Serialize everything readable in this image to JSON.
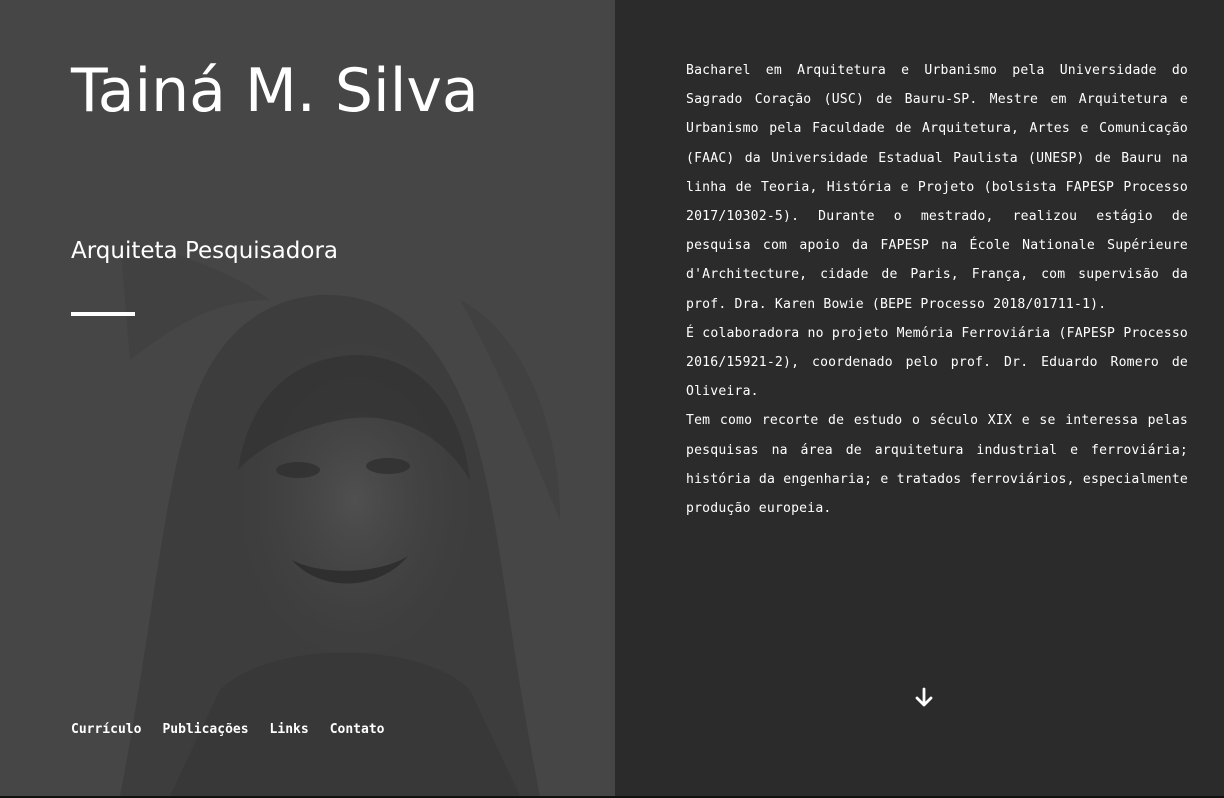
{
  "profile": {
    "name": "Tainá M. Silva",
    "subtitle": "Arquiteta Pesquisadora"
  },
  "nav": {
    "items": [
      "Currículo",
      "Publicações",
      "Links",
      "Contato"
    ]
  },
  "bio": {
    "paragraphs": [
      "Bacharel em Arquitetura e Urbanismo pela Universidade do Sagrado Coração (USC) de Bauru-SP. Mestre em Arquitetura e Urbanismo pela Faculdade de Arquitetura, Artes e Comunicação (FAAC) da Universidade Estadual Paulista (UNESP) de Bauru na linha de Teoria, História e Projeto (bolsista FAPESP Processo 2017/10302-5). Durante o mestrado, realizou estágio de pesquisa com apoio da FAPESP na École Nationale Supérieure d'Architecture, cidade de Paris, França, com supervisão da prof. Dra. Karen Bowie (BEPE Processo 2018/01711-1).",
      "É colaboradora no projeto Memória Ferroviária (FAPESP Processo 2016/15921-2), coordenado pelo prof. Dr. Eduardo Romero de Oliveira.",
      "Tem como recorte de estudo o século XIX e se interessa pelas pesquisas na área de arquitetura industrial e ferroviária; história da engenharia; e tratados ferroviários, especialmente produção europeia."
    ]
  },
  "icons": {
    "scroll": "arrow-down-icon",
    "photo": "portrait-photo"
  },
  "colors": {
    "left_panel": "#464646",
    "right_panel": "#2b2b2b",
    "text": "#ffffff"
  }
}
